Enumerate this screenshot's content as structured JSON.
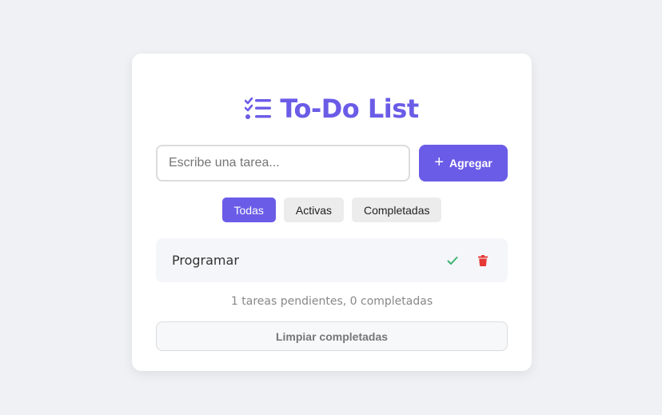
{
  "header": {
    "title": "To-Do List",
    "icon": "list-check-icon",
    "accent_color": "#6b5ce7"
  },
  "form": {
    "input_placeholder": "Escribe una tarea...",
    "input_value": "",
    "add_label": "Agregar",
    "add_icon": "plus-icon"
  },
  "filters": [
    {
      "label": "Todas",
      "active": true
    },
    {
      "label": "Activas",
      "active": false
    },
    {
      "label": "Completadas",
      "active": false
    }
  ],
  "tasks": [
    {
      "text": "Programar",
      "completed": false,
      "actions": [
        "check-icon",
        "trash-icon"
      ]
    }
  ],
  "footer": {
    "summary": "1 tareas pendientes, 0 completadas",
    "clear_label": "Limpiar completadas"
  },
  "colors": {
    "check": "#3cb371",
    "delete": "#e53935",
    "background": "#f0f1f5"
  }
}
